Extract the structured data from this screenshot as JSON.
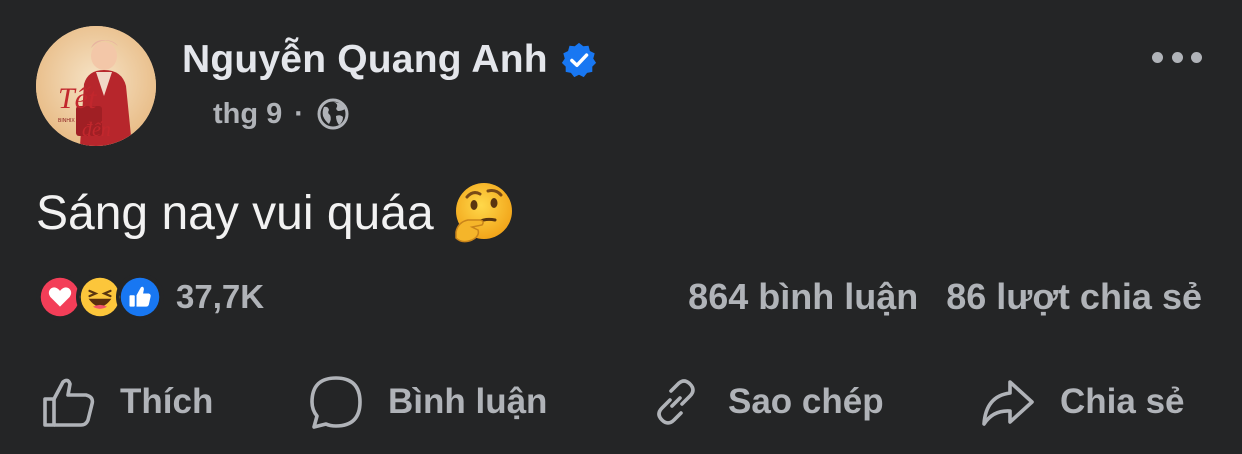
{
  "post": {
    "author": "Nguyễn Quang Anh",
    "date": "thg 9",
    "separator": "·",
    "text": "Sáng nay vui quáa",
    "emoji": "thinking-face"
  },
  "stats": {
    "reactions_count": "37,7K",
    "reaction_types": [
      "love",
      "haha",
      "like"
    ],
    "comments": "864 bình luận",
    "shares": "86 lượt chia sẻ"
  },
  "actions": {
    "like": "Thích",
    "comment": "Bình luận",
    "copy": "Sao chép",
    "share": "Chia sẻ"
  },
  "colors": {
    "background": "#242526",
    "text_primary": "#e4e6eb",
    "text_secondary": "#b0b3b8",
    "verified_blue": "#1877f2",
    "love_red": "#f33e58",
    "like_blue": "#1877f2"
  }
}
